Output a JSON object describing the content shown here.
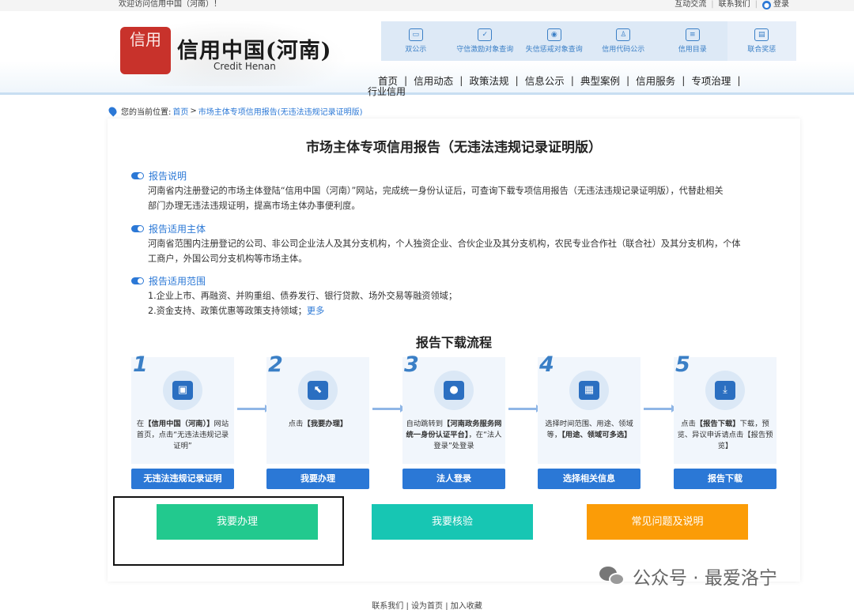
{
  "topbar": {
    "welcome": "欢迎访问信用中国（河南）！",
    "links": [
      "互动交流",
      "联系我们"
    ],
    "login": "登录"
  },
  "logo": {
    "seal": "信用",
    "name_cn": "信用中国(河南)",
    "name_en": "Credit Henan"
  },
  "quick_links": [
    {
      "label": "双公示",
      "icon": "folder-icon"
    },
    {
      "label": "守信激励对象查询",
      "icon": "certificate-icon"
    },
    {
      "label": "失信惩戒对象查询",
      "icon": "eye-icon"
    },
    {
      "label": "信用代码公示",
      "icon": "person-icon"
    },
    {
      "label": "信用目录",
      "icon": "list-icon"
    },
    {
      "label": "联合奖惩",
      "icon": "document-icon"
    }
  ],
  "nav": {
    "items": [
      "首页",
      "信用动态",
      "政策法规",
      "信息公示",
      "典型案例",
      "信用服务",
      "专项治理"
    ],
    "sub": "行业信用"
  },
  "breadcrumb": {
    "prefix": "您的当前位置:",
    "home": "首页",
    "separator": ">",
    "current": "市场主体专项信用报告(无违法违规记录证明版)"
  },
  "page": {
    "title": "市场主体专项信用报告（无违法违规记录证明版）",
    "sections": [
      {
        "heading": "报告说明",
        "lines": [
          "河南省内注册登记的市场主体登陆“信用中国（河南）”网站，完成统一身份认证后，可查询下载专项信用报告（无违法违规记录证明版），代替赴相关",
          "部门办理无违法违规证明，提高市场主体办事便利度。"
        ]
      },
      {
        "heading": "报告适用主体",
        "lines": [
          "河南省范围内注册登记的公司、非公司企业法人及其分支机构，个人独资企业、合伙企业及其分支机构，农民专业合作社（联合社）及其分支机构，个体",
          "工商户，外国公司分支机构等市场主体。"
        ]
      },
      {
        "heading": "报告适用范围",
        "lines": [
          "1.企业上市、再融资、并购重组、债券发行、银行贷款、场外交易等融资领域；",
          "2.资金支持、政策优惠等政策支持领域；"
        ],
        "more": "更多"
      }
    ],
    "flow_title": "报告下载流程",
    "steps": [
      {
        "num": "1",
        "icon": "monitor-icon",
        "glyph": "▣",
        "text_a": "在",
        "text_b": "【信用中国（河南）】",
        "text_c": "网站首页，点击“无违法违规记录证明”",
        "button": "无违法违规记录证明"
      },
      {
        "num": "2",
        "icon": "cursor-icon",
        "glyph": "⬉",
        "text_a": "点击",
        "text_b": "【我要办理】",
        "text_c": "",
        "button": "我要办理"
      },
      {
        "num": "3",
        "icon": "user-icon",
        "glyph": "●",
        "text_a": "自动跳转到",
        "text_b": "【河南政务服务网统一身份认证平台】",
        "text_c": "，在“法人登录”处登录",
        "button": "法人登录"
      },
      {
        "num": "4",
        "icon": "calendar-icon",
        "glyph": "▦",
        "text_a": "选择时间范围、用途、领域等，",
        "text_b": "【用途、领域可多选】",
        "text_c": "",
        "button": "选择相关信息"
      },
      {
        "num": "5",
        "icon": "download-doc-icon",
        "glyph": "⤓",
        "text_a": "点击",
        "text_b": "【报告下载】",
        "text_c": "下载，预览、异议申诉请点击【报告预览】",
        "button": "报告下载"
      }
    ],
    "actions": [
      "我要办理",
      "我要核验",
      "常见问题及说明"
    ]
  },
  "watermark": "公众号 · 最爱洛宁",
  "footer": {
    "links": [
      "联系我们",
      "设为首页",
      "加入收藏"
    ],
    "separator": "|"
  },
  "colors": {
    "primary": "#2b78d6",
    "green": "#22c98e",
    "teal": "#17c6b3",
    "orange": "#fb9c07"
  }
}
